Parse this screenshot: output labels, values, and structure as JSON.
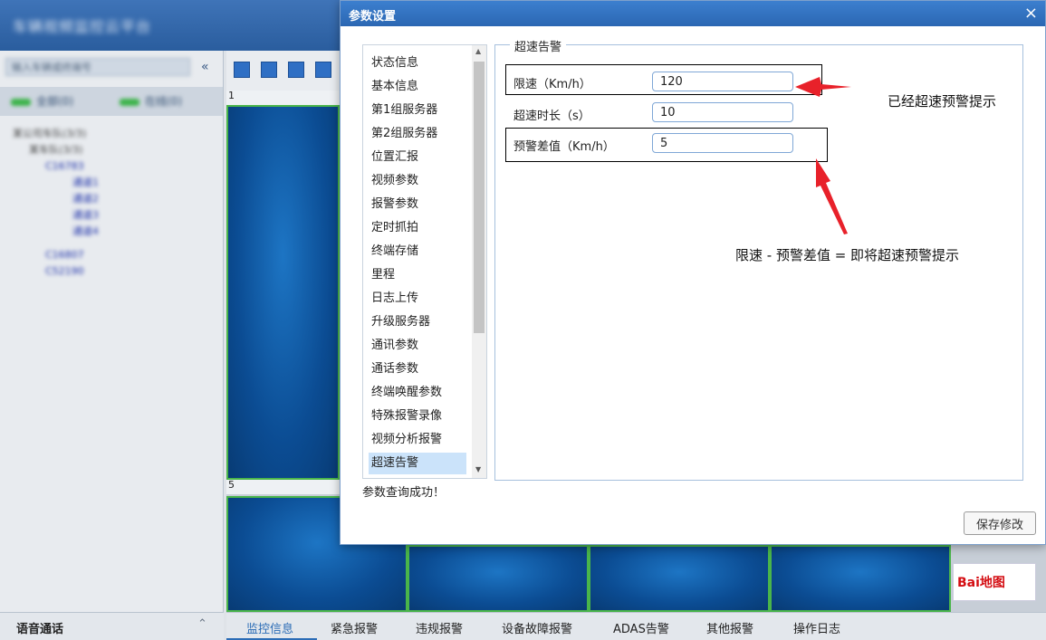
{
  "app": {
    "title": "车辆视频监控云平台",
    "search_placeholder": "输入车辆或终端号",
    "collapse_icon": "double-chevron-left-icon",
    "tabs": [
      "全部(0)",
      "在线(0)"
    ],
    "tree": [
      {
        "label": "某公司车队(3/3)"
      },
      {
        "label": "某车队(3/3)"
      },
      {
        "label": "C16783"
      },
      {
        "label": "通道1"
      },
      {
        "label": "通道2"
      },
      {
        "label": "通道3"
      },
      {
        "label": "通道4"
      },
      {
        "label": "C16807"
      },
      {
        "label": "C52190"
      }
    ],
    "voice_label": "语音通话",
    "voice_toggle": "≈",
    "video_cells": [
      "1",
      "5"
    ],
    "map_logo": "Bai地图",
    "bottom_tabs": [
      "监控信息",
      "紧急报警",
      "违规报警",
      "设备故障报警",
      "ADAS告警",
      "其他报警",
      "操作日志"
    ],
    "active_bottom_tab": 0
  },
  "dialog": {
    "title": "参数设置",
    "close_icon": "×",
    "menu": [
      "状态信息",
      "基本信息",
      "第1组服务器",
      "第2组服务器",
      "位置汇报",
      "视频参数",
      "报警参数",
      "定时抓拍",
      "终端存储",
      "里程",
      "日志上传",
      "升级服务器",
      "通讯参数",
      "通话参数",
      "终端唤醒参数",
      "特殊报警录像",
      "视频分析报警",
      "超速告警"
    ],
    "active_menu_index": 17,
    "scroll_up_icon": "▲",
    "scroll_down_icon": "▼",
    "status_text": "参数查询成功！",
    "section_title": "超速告警",
    "fields": {
      "speed_limit": {
        "label": "限速（Km/h）",
        "value": "120"
      },
      "overspeed_duration": {
        "label": "超速时长（s）",
        "value": "10"
      },
      "warning_diff": {
        "label": "预警差值（Km/h）",
        "value": "5"
      }
    },
    "save_label": "保存修改"
  },
  "annotations": {
    "note_1": "已经超速预警提示",
    "note_2": "限速 - 预警差值 = 即将超速预警提示",
    "arrow_color": "#e8212a"
  }
}
